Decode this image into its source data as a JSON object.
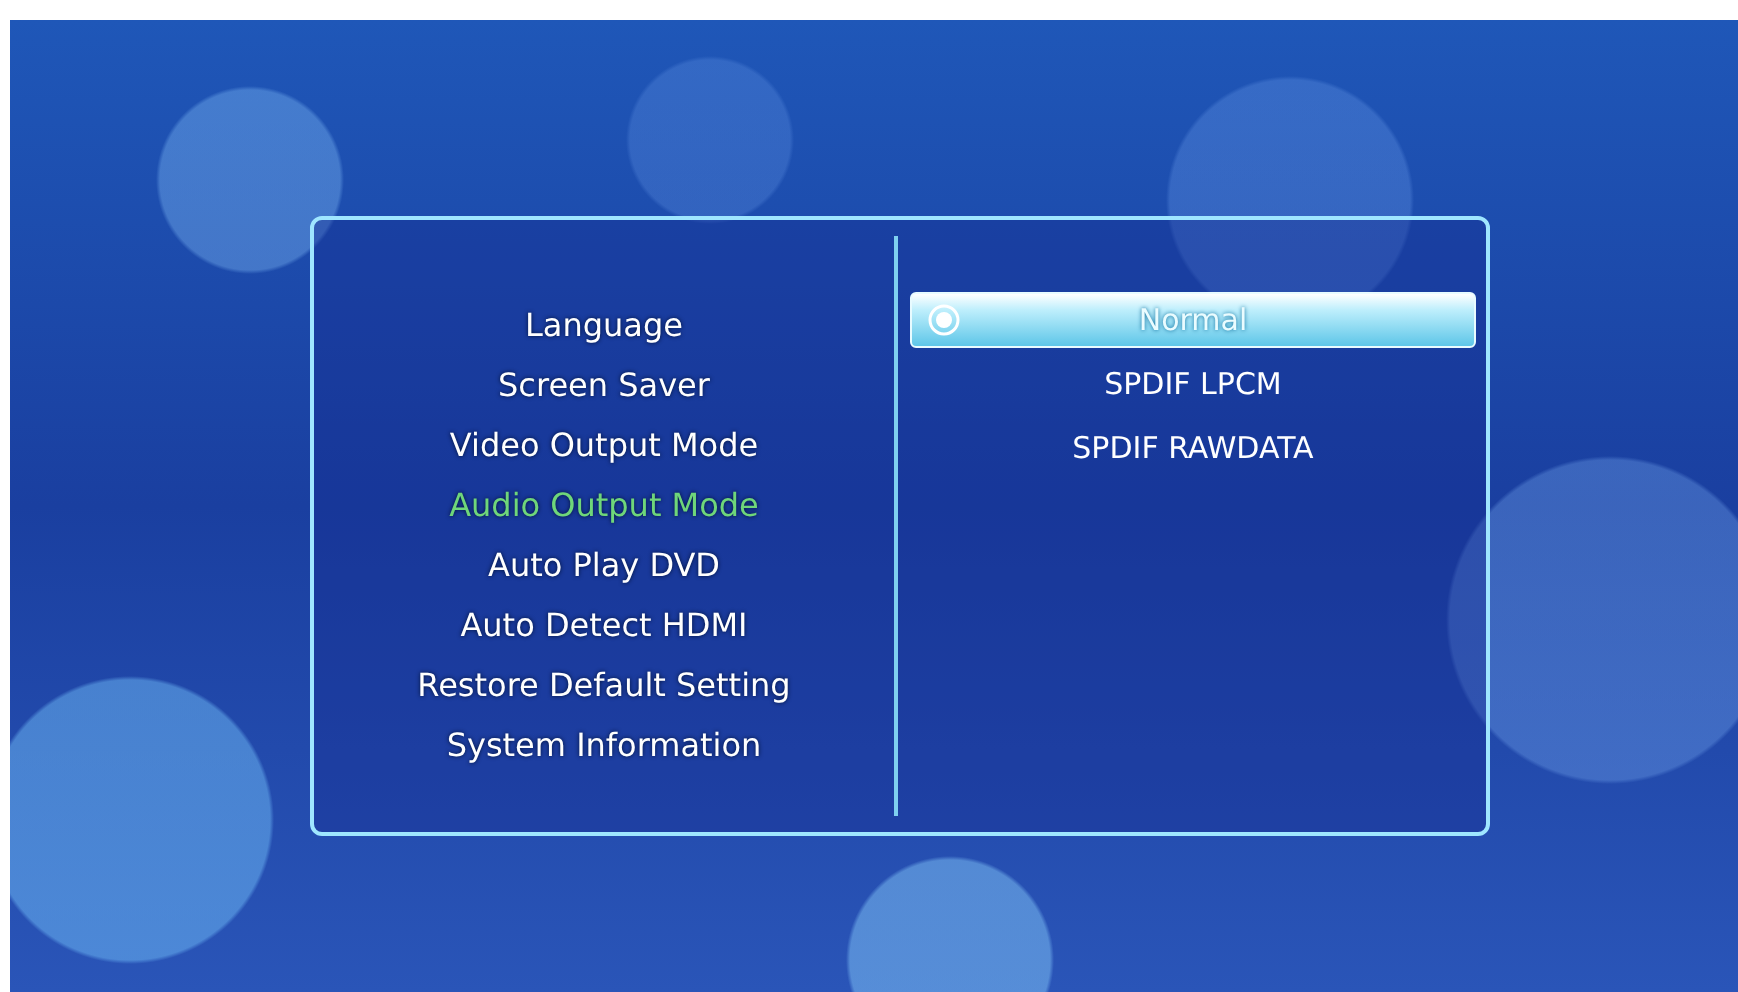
{
  "menu": {
    "items": [
      {
        "label": "Language",
        "selected": false
      },
      {
        "label": "Screen Saver",
        "selected": false
      },
      {
        "label": "Video Output Mode",
        "selected": false
      },
      {
        "label": "Audio Output Mode",
        "selected": true
      },
      {
        "label": "Auto Play DVD",
        "selected": false
      },
      {
        "label": "Auto Detect HDMI",
        "selected": false
      },
      {
        "label": "Restore Default Setting",
        "selected": false
      },
      {
        "label": "System Information",
        "selected": false
      }
    ]
  },
  "options": [
    {
      "label": "Normal",
      "selected": true
    },
    {
      "label": "SPDIF LPCM",
      "selected": false
    },
    {
      "label": "SPDIF RAWDATA",
      "selected": false
    }
  ]
}
